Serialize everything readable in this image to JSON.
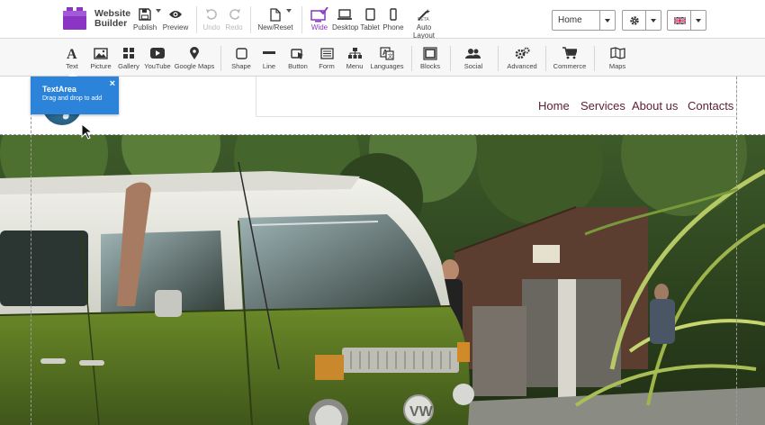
{
  "app": {
    "name_line1": "Website",
    "name_line2": "Builder"
  },
  "top_toolbar": {
    "publish": "Publish",
    "preview": "Preview",
    "undo": "Undo",
    "redo": "Redo",
    "new_reset": "New/Reset",
    "wide": "Wide",
    "desktop": "Desktop",
    "tablet": "Tablet",
    "phone": "Phone",
    "auto_layout": "Auto Layout",
    "beta": "BETA",
    "page_select": "Home"
  },
  "element_toolbar": {
    "text": "Text",
    "picture": "Picture",
    "gallery": "Gallery",
    "youtube": "YouTube",
    "google_maps": "Google Maps",
    "shape": "Shape",
    "line": "Line",
    "button": "Button",
    "form": "Form",
    "menu": "Menu",
    "languages": "Languages",
    "blocks": "Blocks",
    "social": "Social",
    "advanced": "Advanced",
    "commerce": "Commerce",
    "maps": "Maps"
  },
  "site_nav": {
    "items": [
      "Home",
      "Services",
      "About us",
      "Contacts"
    ]
  },
  "tooltip": {
    "title": "TextArea",
    "body": "Drag and drop to add",
    "close": "×"
  },
  "colors": {
    "accent_purple": "#8a35c4",
    "nav_text": "#5c1e33",
    "tooltip_blue": "#2b84d9"
  }
}
